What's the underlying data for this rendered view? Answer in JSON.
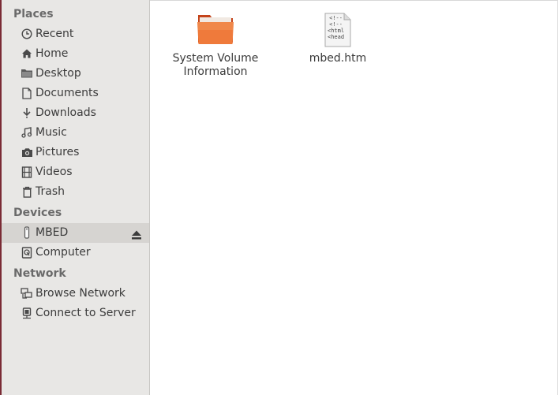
{
  "sidebar": {
    "sections": [
      {
        "header": "Places",
        "items": [
          {
            "label": "Recent",
            "icon": "recent-icon"
          },
          {
            "label": "Home",
            "icon": "home-icon"
          },
          {
            "label": "Desktop",
            "icon": "folder-icon"
          },
          {
            "label": "Documents",
            "icon": "document-icon"
          },
          {
            "label": "Downloads",
            "icon": "download-icon"
          },
          {
            "label": "Music",
            "icon": "music-icon"
          },
          {
            "label": "Pictures",
            "icon": "camera-icon"
          },
          {
            "label": "Videos",
            "icon": "film-icon"
          },
          {
            "label": "Trash",
            "icon": "trash-icon"
          }
        ]
      },
      {
        "header": "Devices",
        "items": [
          {
            "label": "MBED",
            "icon": "usb-drive-icon",
            "selected": true,
            "eject": true
          },
          {
            "label": "Computer",
            "icon": "computer-icon"
          }
        ]
      },
      {
        "header": "Network",
        "items": [
          {
            "label": "Browse Network",
            "icon": "network-icon"
          },
          {
            "label": "Connect to Server",
            "icon": "server-icon"
          }
        ]
      }
    ]
  },
  "files": [
    {
      "name_line1": "System Volume",
      "name_line2": "Information",
      "icon": "folder-icon",
      "folder_color": "#e8642a"
    },
    {
      "name_line1": "mbed.htm",
      "name_line2": "",
      "icon": "html-file-icon",
      "preview": "<!--\n<!--\n<html\n<head"
    }
  ],
  "colors": {
    "sidebar_bg": "#e8e7e5",
    "selected_bg": "#d6d4d1",
    "left_edge": "#7a2b35"
  }
}
